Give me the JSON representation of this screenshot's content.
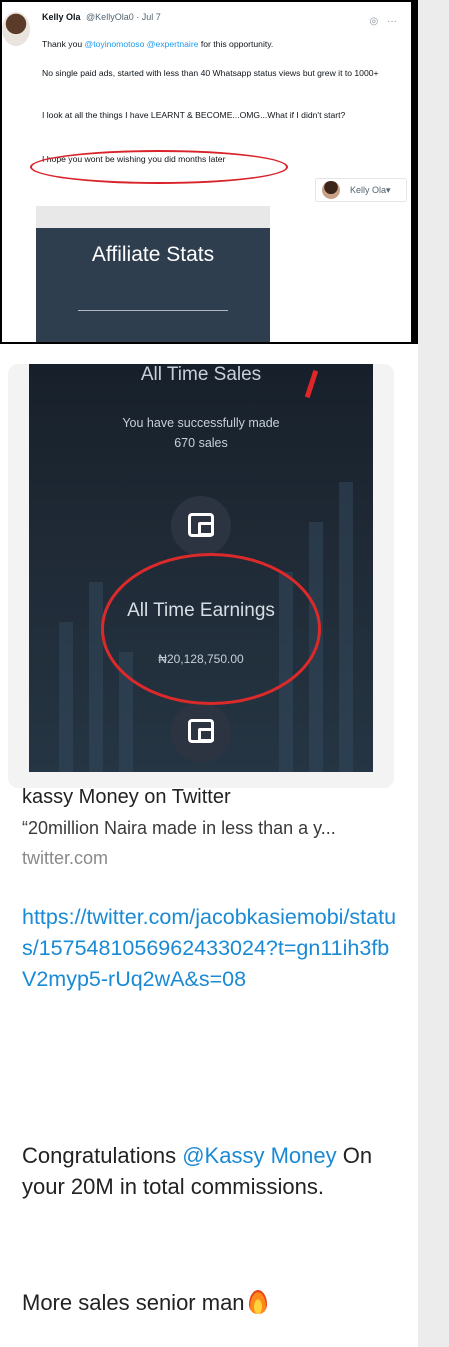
{
  "tweet": {
    "author_name": "Kelly Ola",
    "handle_time": "@KellyOla0 · Jul 7",
    "more_icon": "ellipsis-icon",
    "camera_icon": "camera-icon",
    "line1_pre": "Thank you ",
    "line1_mention1": "@toyinomotoso",
    "line1_mention2": " @expertnaire",
    "line1_post": " for this opportunity.",
    "para2": "No single paid ads, started with less than 40 Whatsapp status views but grew it to 1000+",
    "para3": "I look at all the things I have LEARNT & BECOME...OMG...What if I didn't start?",
    "para4": "I hope you wont be wishing you did months later",
    "profile_chip": "Kelly Ola",
    "stats_title": "Affiliate Stats"
  },
  "preview": {
    "all_time_sales": "All Time Sales",
    "sales_line1": "You have successfully made",
    "sales_line2": "670 sales",
    "earnings_label": "All Time Earnings",
    "earnings_value": "₦20,128,750.00",
    "link_title": "kassy Money on Twitter",
    "link_desc": "“20million Naira made in less than a y...",
    "link_domain": "twitter.com"
  },
  "message": {
    "url": "https://twitter.com/jacobkasiemobi/status/1575481056962433024?t=gn11ih3fbV2myp5-rUq2wA&s=08",
    "congrats_pre": "Congratulations ",
    "congrats_mention": "@Kassy Money",
    "congrats_post": " On your 20M in total commissions.",
    "closing": "More sales senior man"
  },
  "colors": {
    "link": "#1a8ad4",
    "highlight_circle": "#dc2a2a",
    "card_dark": "#2f3e4f"
  }
}
